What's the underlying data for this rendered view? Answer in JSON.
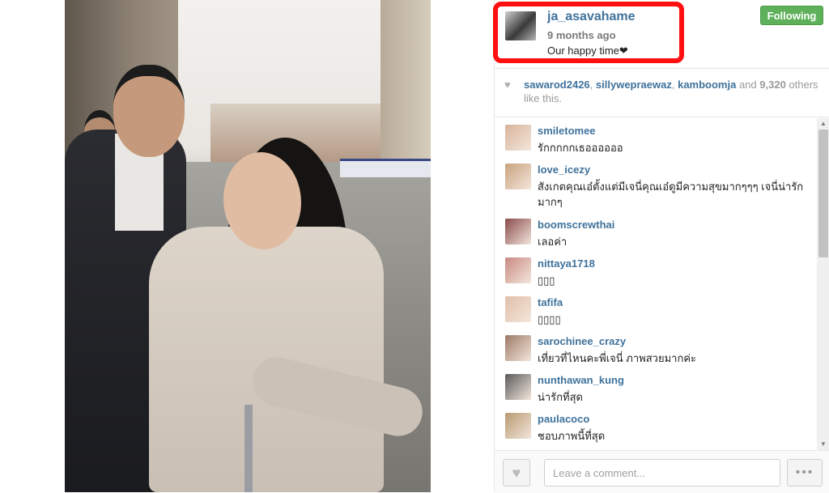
{
  "post": {
    "owner": "ja_asavahame",
    "time": "9 months ago",
    "caption": "Our happy time❤",
    "follow_label": "Following"
  },
  "likes": {
    "user1": "sawarod2426",
    "sep1": ", ",
    "user2": "sillywepraewaz",
    "sep2": ", ",
    "user3": "kamboomja",
    "and": " and ",
    "count": "9,320",
    "suffix": " others like this."
  },
  "comments": [
    {
      "user": "smiletomee",
      "text": "รักกกกกเธออออออ",
      "avatar_color": "#d9b49a"
    },
    {
      "user": "love_icezy",
      "text": "สังเกตคุณเอ๋ตั้งแต่มีเจนี่คุณเอ๋ดูมีความสุขมากๆๆๆ เจนี่น่ารักมากๆ",
      "avatar_color": "#c9a27e"
    },
    {
      "user": "boomscrewthai",
      "text": "เลอค่า",
      "avatar_color": "#8a4b4b"
    },
    {
      "user": "nittaya1718",
      "text": "▯▯▯",
      "avatar_color": "#c98a82"
    },
    {
      "user": "tafifa",
      "text": "▯▯▯▯",
      "avatar_color": "#e0bfa8"
    },
    {
      "user": "sarochinee_crazy",
      "text": "เที่ยวที่ไหนคะพี่เจนี่ ภาพสวยมากค่ะ",
      "avatar_color": "#9d7a66"
    },
    {
      "user": "nunthawan_kung",
      "text": "น่ารักที่สุด",
      "avatar_color": "#5a5a5a"
    },
    {
      "user": "paulacoco",
      "text": "ชอบภาพนี้ที่สุด",
      "avatar_color": "#b89a72"
    }
  ],
  "comment_box": {
    "placeholder": "Leave a comment...",
    "more_label": "•••",
    "like_glyph": "♥"
  },
  "icons": {
    "likes_heart": "heart-icon",
    "scroll_up": "▲",
    "scroll_down": "▼"
  },
  "colors": {
    "username": "#3f729b",
    "follow_green": "#5eb15a",
    "highlight": "#ff1010"
  }
}
